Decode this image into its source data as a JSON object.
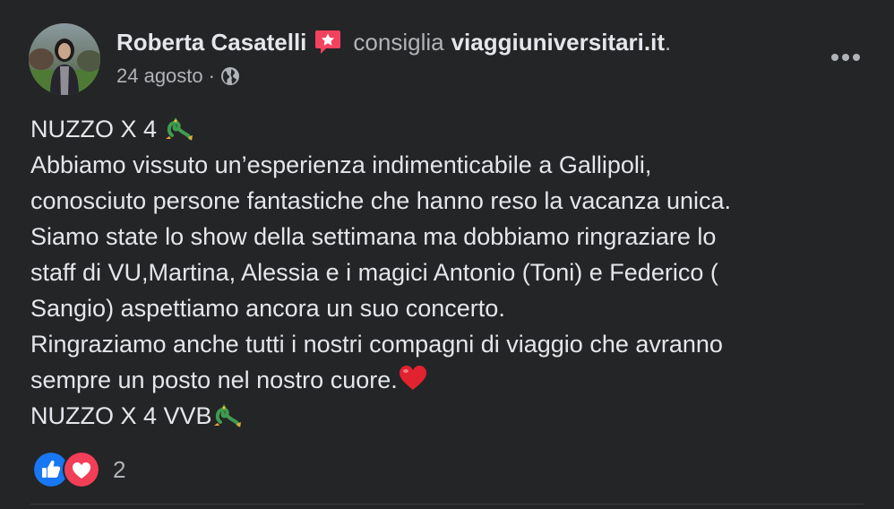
{
  "post": {
    "author": "Roberta Casatelli",
    "verb": "consiglia",
    "page": "viaggiuniversitari.it",
    "period": ".",
    "date": "24 agosto",
    "separator": "·",
    "audience_icon": "globe-icon",
    "recommend_icon": "recommend-star-icon",
    "more_icon": "more-options-icon",
    "lines": [
      "NUZZO X 4 ",
      "Abbiamo vissuto un’esperienza indimenticabile a Gallipoli,",
      "conosciuto persone fantastiche che hanno reso la vacanza unica.",
      "Siamo state lo show della settimana ma dobbiamo ringraziare lo",
      "staff di VU,Martina, Alessia e i magici Antonio (Toni) e Federico (",
      "Sangio) aspettiamo ancora un suo concerto.",
      "Ringraziamo anche tutti i nostri compagni di viaggio che avranno",
      "sempre un posto nel nostro cuore.",
      "NUZZO X 4 VVB"
    ],
    "emojis": {
      "line1": "dragon-emoji",
      "line8": "red-heart-emoji",
      "line9": "dragon-emoji"
    },
    "reactions": {
      "types": [
        "like-icon",
        "love-icon"
      ],
      "count": "2"
    }
  },
  "colors": {
    "background": "#242526",
    "text_primary": "#e4e6eb",
    "text_secondary": "#b0b3b8",
    "like_blue": "#1877f2",
    "love_red": "#f33e58",
    "recommend_red": "#f3425f"
  }
}
